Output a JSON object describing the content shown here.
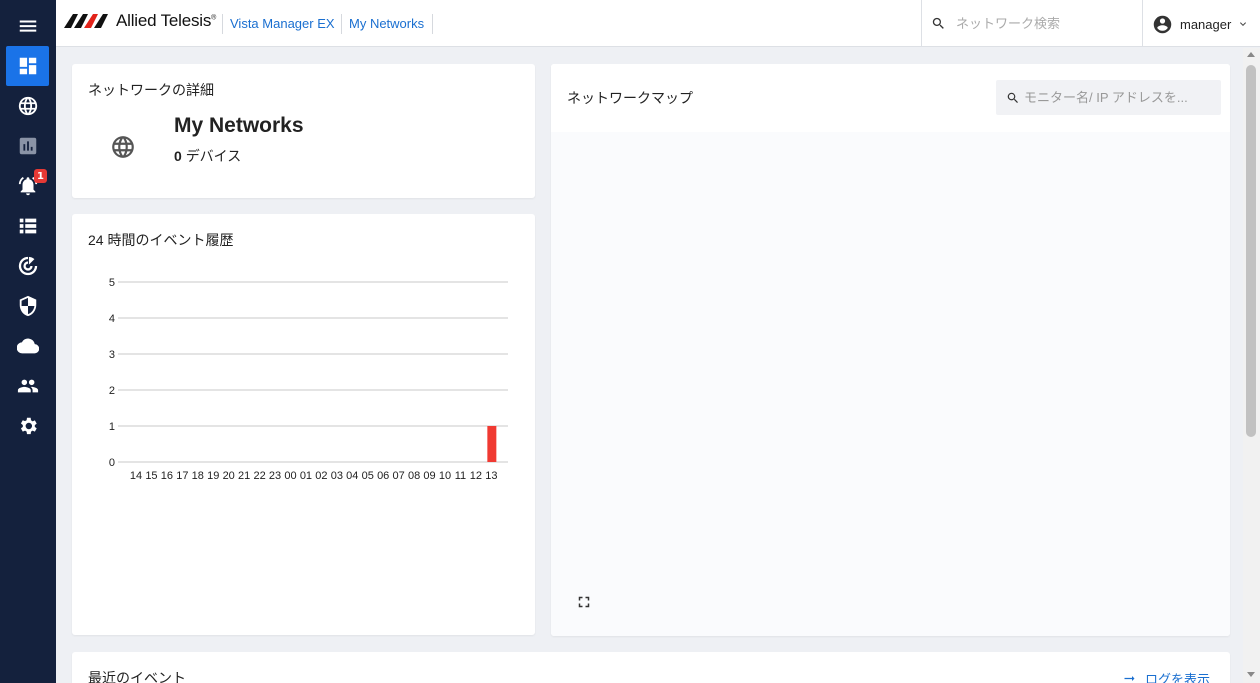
{
  "header": {
    "brand": "Allied Telesis",
    "brand_tm": "®",
    "breadcrumbs": [
      "Vista Manager EX",
      "My Networks"
    ],
    "search_placeholder": "ネットワーク検索",
    "user": "manager"
  },
  "sidebar": {
    "items": [
      {
        "icon": "menu-icon"
      },
      {
        "icon": "dashboard-icon",
        "active": true
      },
      {
        "icon": "globe-icon"
      },
      {
        "icon": "analytics-icon"
      },
      {
        "icon": "bell-icon",
        "badge": "1"
      },
      {
        "icon": "list-icon"
      },
      {
        "icon": "radar-icon"
      },
      {
        "icon": "shield-icon"
      },
      {
        "icon": "cloud-icon"
      },
      {
        "icon": "people-icon"
      },
      {
        "icon": "gear-icon"
      }
    ]
  },
  "network_details": {
    "title": "ネットワークの詳細",
    "name": "My Networks",
    "device_count": "0",
    "device_label": "デバイス"
  },
  "event_history": {
    "title": "24 時間のイベント履歴"
  },
  "network_map": {
    "title": "ネットワークマップ",
    "search_placeholder": "モニター名/ IP アドレスを..."
  },
  "recent_events": {
    "title": "最近のイベント",
    "log_link": "ログを表示"
  },
  "colors": {
    "sidebar_bg": "#14213d",
    "accent": "#1a73e8",
    "link": "#1a6fd0",
    "bar": "#f03a32",
    "badge": "#e53935"
  },
  "chart_data": {
    "type": "bar",
    "categories": [
      "14",
      "15",
      "16",
      "17",
      "18",
      "19",
      "20",
      "21",
      "22",
      "23",
      "00",
      "01",
      "02",
      "03",
      "04",
      "05",
      "06",
      "07",
      "08",
      "09",
      "10",
      "11",
      "12",
      "13"
    ],
    "values": [
      0,
      0,
      0,
      0,
      0,
      0,
      0,
      0,
      0,
      0,
      0,
      0,
      0,
      0,
      0,
      0,
      0,
      0,
      0,
      0,
      0,
      0,
      0,
      1
    ],
    "title": "24 時間のイベント履歴",
    "xlabel": "",
    "ylabel": "",
    "ylim": [
      0,
      5
    ],
    "yticks": [
      0,
      1,
      2,
      3,
      4,
      5
    ],
    "grid": true
  }
}
